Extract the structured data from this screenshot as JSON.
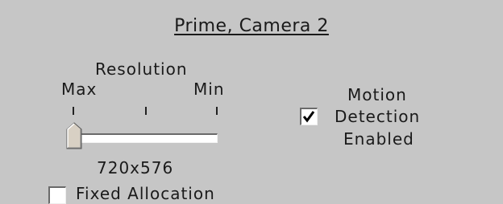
{
  "panel": {
    "title": "Prime, Camera 2"
  },
  "resolution": {
    "label": "Resolution",
    "max_label": "Max",
    "min_label": "Min",
    "value": "720x576",
    "slider_level": 0
  },
  "motion_detection": {
    "line1": "Motion",
    "line2": "Detection",
    "line3": "Enabled",
    "checked": true
  },
  "fixed_allocation": {
    "label": "Fixed Allocation",
    "checked": false
  },
  "colors": {
    "background": "#c6c6c6",
    "text": "#1a1a1a"
  }
}
